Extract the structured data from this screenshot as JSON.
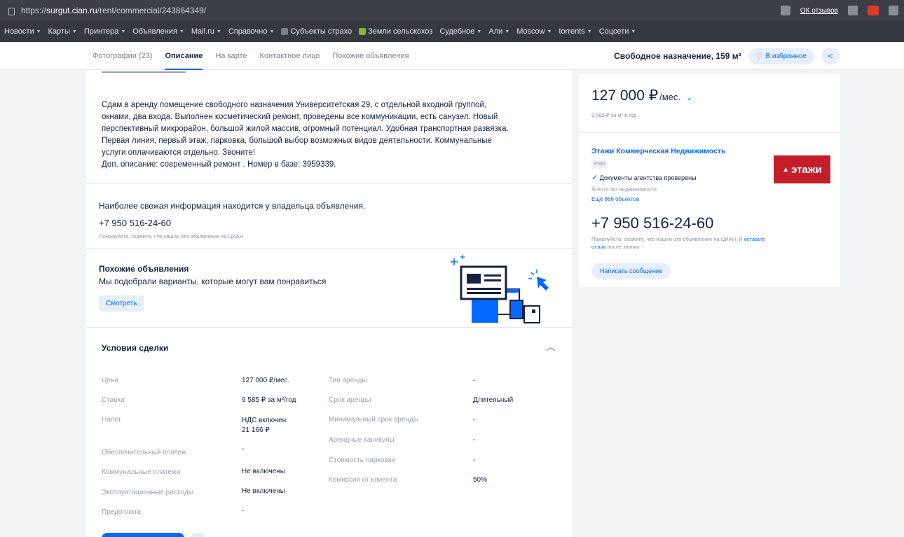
{
  "browser": {
    "url_prefix": "https://",
    "url_host": "surgut.cian.ru",
    "url_path": "/rent/commercial/243864349/",
    "reviews_button": "ОК отзывов",
    "bookmarks": [
      {
        "label": "Новости",
        "caret": true
      },
      {
        "label": "Карты",
        "caret": true
      },
      {
        "label": "Принтера",
        "caret": true
      },
      {
        "label": "Объявления",
        "caret": true
      },
      {
        "label": "Mail.ru",
        "caret": true
      },
      {
        "label": "Справочно",
        "caret": true
      },
      {
        "label": "Субъекты страхо",
        "caret": false,
        "icon": "bookmark-icon"
      },
      {
        "label": "Земли сельскохоз",
        "caret": false,
        "icon": "green-leaf-icon"
      },
      {
        "label": "Судебное",
        "caret": true
      },
      {
        "label": "Али",
        "caret": true
      },
      {
        "label": "Moscow",
        "caret": true
      },
      {
        "label": "torrents",
        "caret": true
      },
      {
        "label": "Соцсети",
        "caret": true
      }
    ]
  },
  "tabs": [
    "Фотографии (23)",
    "Описание",
    "На карте",
    "Контактное лицо",
    "Похожие объявления"
  ],
  "header": {
    "title": "Свободное назначение, 159 м²",
    "favorite": "В избранное"
  },
  "description": {
    "text": "Сдам в аренду помещение свободного назначения Университетская 29, с отдельной входной группой,\nокнами, два входа. Выполнен косметический ремонт, проведены все коммуникации, есть санузел. Новый\nперспективный микрорайон, большой жилой массив, огромный потенциал. Удобная транспортная развязка.\nПервая линия, первый этаж, парковка, большой выбор возможных видов деятельности. Коммунальные\nуслуги оплачиваются отдельно. Звоните!\n Доп. описание: современный ремонт . Номер в базе: 3959339."
  },
  "owner": {
    "info": "Наиболее свежая информация находится у владельца объявления.",
    "phone": "+7 950 516-24-60",
    "note": "Пожалуйста, скажите, что нашли это объявление на ЦИАН"
  },
  "similar": {
    "title": "Похожие объявления",
    "subtitle": "Мы подобрали варианты, которые могут вам понравиться",
    "button": "Смотреть"
  },
  "deal": {
    "title": "Условия сделки",
    "left": [
      {
        "key": "Цена",
        "value": "127 000 ₽/мес."
      },
      {
        "key": "Ставка",
        "value": "9 585 ₽ за м²/год"
      },
      {
        "key": "Налог",
        "value": "НДС включен:\n21 166 ₽"
      },
      {
        "key": "Обеспечительный платеж",
        "value": "-"
      },
      {
        "key": "Коммунальные платежи",
        "value": "Не включены"
      },
      {
        "key": "Эксплуатационные расходы",
        "value": "Не включены"
      },
      {
        "key": "Предоплата",
        "value": "-"
      }
    ],
    "right": [
      {
        "key": "Тип аренды",
        "value": "-"
      },
      {
        "key": "Срок аренды",
        "value": "Длительный"
      },
      {
        "key": "Минимальный срок аренды",
        "value": "-"
      },
      {
        "key": "Арендные каникулы",
        "value": "-"
      },
      {
        "key": "Стоимость парковки",
        "value": "-"
      },
      {
        "key": "Комиссия от клиента",
        "value": "50%"
      }
    ]
  },
  "sidebar": {
    "price": "127 000 ₽",
    "price_unit": "/мес.",
    "price_sub": "9 585 ₽ за м² в год",
    "agent_name": "Этажи Коммерческая Недвижимость",
    "agent_badge": "PRO",
    "agent_docs": "Документы агентства проверены",
    "agent_type": "Агентство недвижимости",
    "agent_more": "Ещё 866 объектов",
    "agent_logo": "этажи",
    "agent_phone": "+7 950 516-24-60",
    "agent_note_1": "Пожалуйста, скажите, что нашли это объявление на ЦИАН. И ",
    "agent_note_link": "оставьте отзыв",
    "agent_note_2": " после звонка",
    "write_button": "Написать сообщение"
  },
  "colors": {
    "accent": "#0468ff",
    "text": "#152242",
    "muted": "#8b93a3",
    "brand_logo": "#c41e2a"
  }
}
